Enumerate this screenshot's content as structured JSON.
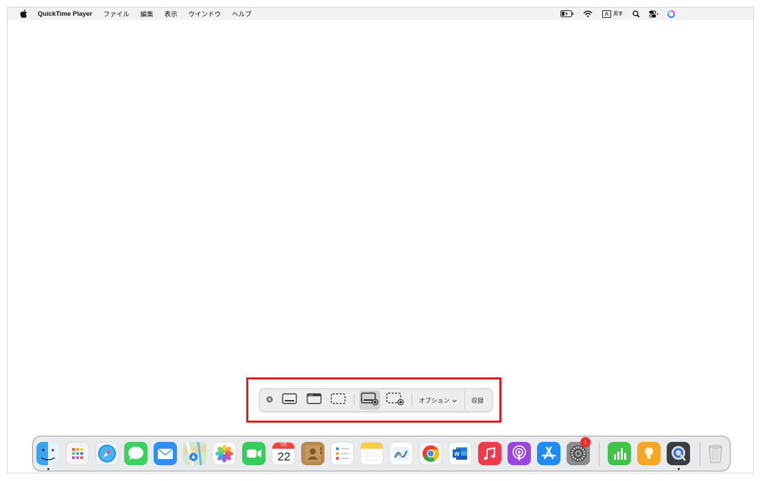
{
  "menubar": {
    "apple_icon": "apple-logo-icon",
    "items": [
      "QuickTime Player",
      "ファイル",
      "編集",
      "表示",
      "ウインドウ",
      "ヘルプ"
    ],
    "status": {
      "battery_icon": "battery-charging-icon",
      "wifi_icon": "wifi-icon",
      "input_source_box": "A",
      "input_source_label": "英字",
      "search_icon": "spotlight-search-icon",
      "control_center_icon": "control-center-icon",
      "siri_icon": "siri-icon"
    }
  },
  "capture_toolbar": {
    "close_icon": "close-icon",
    "capture_entire_screen_icon": "capture-entire-screen-icon",
    "capture_window_icon": "capture-window-icon",
    "capture_selection_icon": "capture-selection-icon",
    "record_entire_screen_icon": "record-entire-screen-icon",
    "record_selection_icon": "record-selection-icon",
    "options_label": "オプション",
    "record_label": "収録",
    "selected": "record-entire-screen",
    "highlight_color": "#e0191c"
  },
  "dock": {
    "apps": [
      {
        "name": "Finder",
        "icon": "finder-icon",
        "running": true
      },
      {
        "name": "Launchpad",
        "icon": "launchpad-icon",
        "running": false
      },
      {
        "name": "Safari",
        "icon": "safari-icon",
        "running": false
      },
      {
        "name": "Messages",
        "icon": "messages-icon",
        "running": false
      },
      {
        "name": "Mail",
        "icon": "mail-icon",
        "running": false
      },
      {
        "name": "Maps",
        "icon": "maps-icon",
        "running": false
      },
      {
        "name": "Photos",
        "icon": "photos-icon",
        "running": false
      },
      {
        "name": "FaceTime",
        "icon": "facetime-icon",
        "running": false
      },
      {
        "name": "Calendar",
        "icon": "calendar-icon",
        "running": false,
        "month": "6月",
        "day": "22"
      },
      {
        "name": "Contacts",
        "icon": "contacts-icon",
        "running": false
      },
      {
        "name": "Reminders",
        "icon": "reminders-icon",
        "running": false
      },
      {
        "name": "Notes",
        "icon": "notes-icon",
        "running": false
      },
      {
        "name": "Freeform",
        "icon": "freeform-icon",
        "running": false
      },
      {
        "name": "Chrome",
        "icon": "chrome-icon",
        "running": false
      },
      {
        "name": "Word",
        "icon": "word-icon",
        "running": false
      },
      {
        "name": "Music",
        "icon": "music-icon",
        "running": false
      },
      {
        "name": "Podcasts",
        "icon": "podcasts-icon",
        "running": false
      },
      {
        "name": "App Store",
        "icon": "app-store-icon",
        "running": false
      },
      {
        "name": "System Settings",
        "icon": "system-settings-icon",
        "running": false,
        "badge": "1"
      },
      {
        "name": "Numbers",
        "icon": "numbers-icon",
        "running": false
      },
      {
        "name": "Keynote",
        "icon": "keynote-icon",
        "running": false
      },
      {
        "name": "QuickTime Player",
        "icon": "quicktime-icon",
        "running": true
      },
      {
        "name": "Trash",
        "icon": "trash-icon",
        "running": false
      }
    ]
  }
}
